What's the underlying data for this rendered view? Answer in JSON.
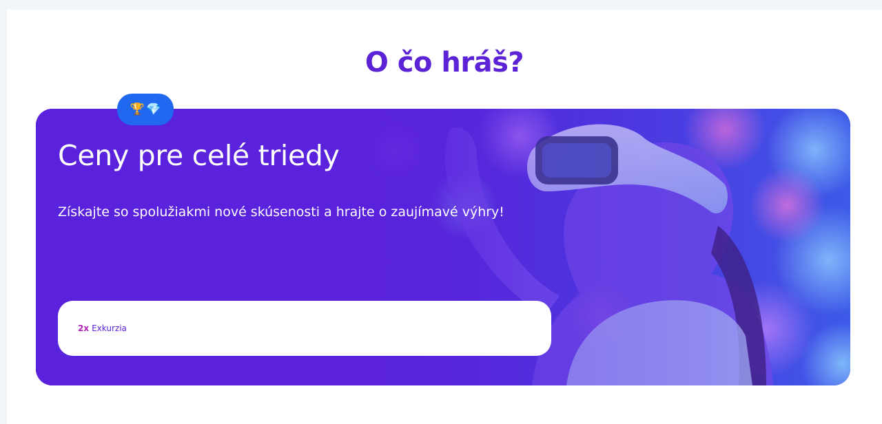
{
  "section": {
    "title": "O čo hráš?"
  },
  "hero": {
    "badge_icons": [
      "trophy-icon",
      "gem-icon"
    ],
    "badge_glyphs": {
      "trophy": "🏆",
      "gem": "💎"
    },
    "title": "Ceny pre celé triedy",
    "subtitle": "Získajte so spolužiakmi nové skúsenosti a hrajte o zaujímavé výhry!",
    "prizes": [
      {
        "count": "2x",
        "name": "Exkurzia"
      }
    ]
  },
  "colors": {
    "title": "#5b22d6",
    "card_background": "#5a22dc",
    "badge": "#2068f0",
    "prize_count": "#b01eb8",
    "prize_name": "#5b22d6",
    "page_background": "#f2f5f8"
  }
}
